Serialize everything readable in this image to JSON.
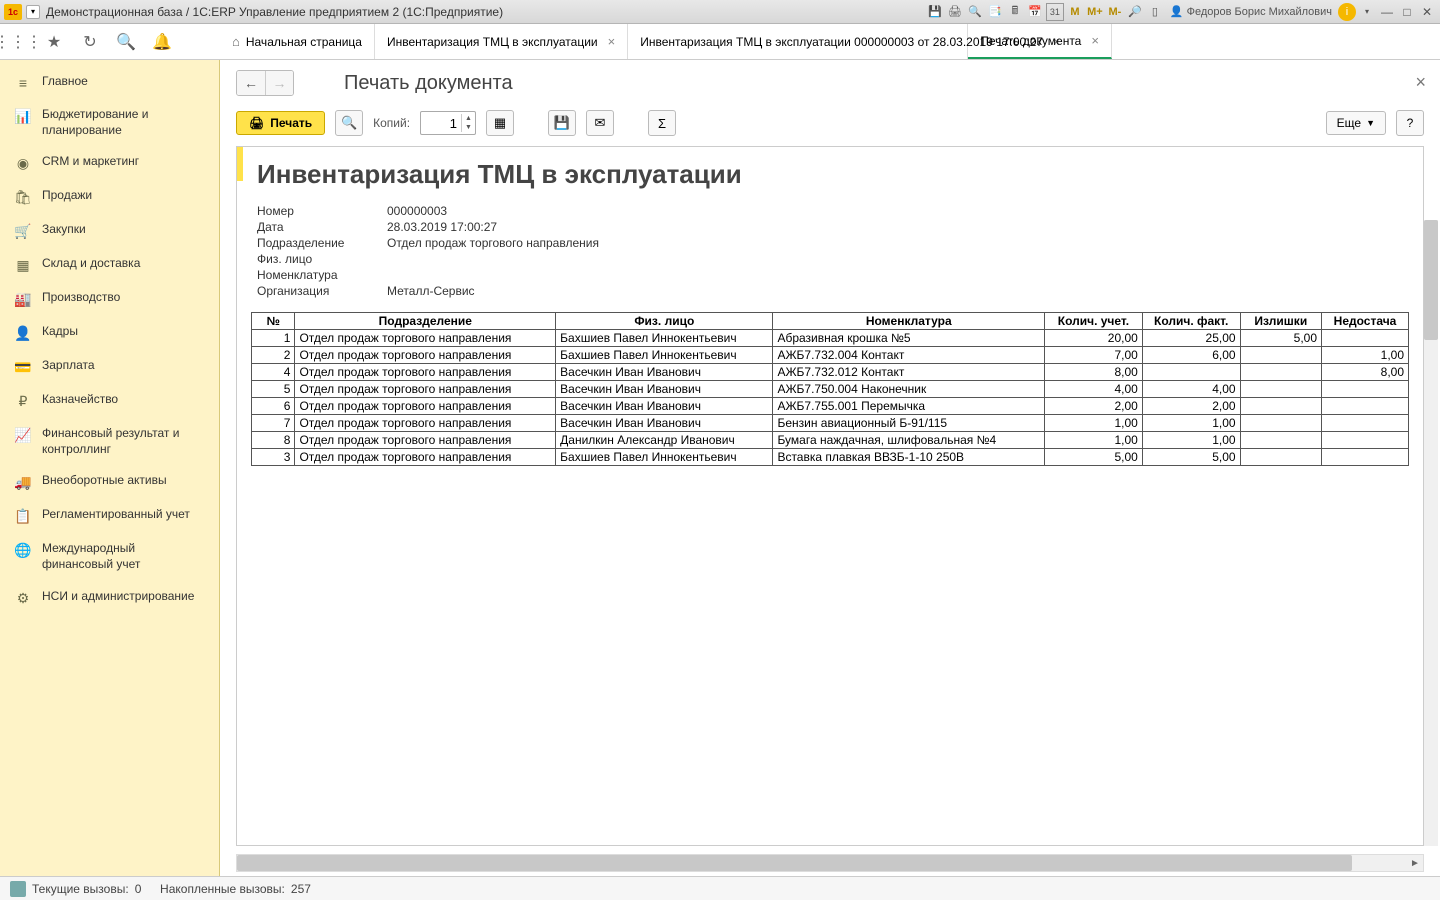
{
  "window": {
    "title": "Демонстрационная база / 1C:ERP Управление предприятием 2  (1С:Предприятие)",
    "user": "Федоров Борис Михайлович",
    "m_labels": [
      "M",
      "M+",
      "M-"
    ]
  },
  "tabs": [
    {
      "label": "Начальная страница",
      "home": true,
      "closable": false
    },
    {
      "label": "Инвентаризация ТМЦ в эксплуатации",
      "closable": true
    },
    {
      "label": "Инвентаризация ТМЦ в эксплуатации 000000003 от 28.03.2019 17:00:27",
      "closable": true
    },
    {
      "label": "Печать документа",
      "closable": true,
      "active": true
    }
  ],
  "sidebar": [
    {
      "icon": "≡",
      "label": "Главное"
    },
    {
      "icon": "📊",
      "label": "Бюджетирование и планирование"
    },
    {
      "icon": "◉",
      "label": "CRM и маркетинг"
    },
    {
      "icon": "🛍",
      "label": "Продажи"
    },
    {
      "icon": "🛒",
      "label": "Закупки"
    },
    {
      "icon": "▦",
      "label": "Склад и доставка"
    },
    {
      "icon": "🏭",
      "label": "Производство"
    },
    {
      "icon": "👤",
      "label": "Кадры"
    },
    {
      "icon": "💳",
      "label": "Зарплата"
    },
    {
      "icon": "₽",
      "label": "Казначейство"
    },
    {
      "icon": "📈",
      "label": "Финансовый результат и контроллинг"
    },
    {
      "icon": "🚚",
      "label": "Внеоборотные активы"
    },
    {
      "icon": "📋",
      "label": "Регламентированный учет"
    },
    {
      "icon": "🌐",
      "label": "Международный финансовый учет"
    },
    {
      "icon": "⚙",
      "label": "НСИ и администрирование"
    }
  ],
  "page": {
    "title": "Печать документа",
    "print_label": "Печать",
    "copies_label": "Копий:",
    "copies_value": "1",
    "more_label": "Еще",
    "help_label": "?"
  },
  "doc": {
    "title": "Инвентаризация ТМЦ в эксплуатации",
    "meta": [
      {
        "k": "Номер",
        "v": "000000003"
      },
      {
        "k": "Дата",
        "v": "28.03.2019 17:00:27"
      },
      {
        "k": "Подразделение",
        "v": "Отдел продаж торгового направления"
      },
      {
        "k": "Физ. лицо",
        "v": ""
      },
      {
        "k": "Номенклатура",
        "v": ""
      },
      {
        "k": "Организация",
        "v": "Металл-Сервис"
      }
    ],
    "columns": [
      "№",
      "Подразделение",
      "Физ. лицо",
      "Номенклатура",
      "Колич. учет.",
      "Колич. факт.",
      "Излишки",
      "Недостача"
    ],
    "rows": [
      {
        "n": "1",
        "dep": "Отдел продаж торгового направления",
        "fio": "Бахшиев Павел Иннокентьевич",
        "nom": "Абразивная крошка №5",
        "u": "20,00",
        "f": "25,00",
        "iz": "5,00",
        "nd": ""
      },
      {
        "n": "2",
        "dep": "Отдел продаж торгового направления",
        "fio": "Бахшиев Павел Иннокентьевич",
        "nom": "АЖБ7.732.004 Контакт",
        "u": "7,00",
        "f": "6,00",
        "iz": "",
        "nd": "1,00"
      },
      {
        "n": "4",
        "dep": "Отдел продаж торгового направления",
        "fio": "Васечкин Иван Иванович",
        "nom": "АЖБ7.732.012 Контакт",
        "u": "8,00",
        "f": "",
        "iz": "",
        "nd": "8,00"
      },
      {
        "n": "5",
        "dep": "Отдел продаж торгового направления",
        "fio": "Васечкин Иван Иванович",
        "nom": "АЖБ7.750.004 Наконечник",
        "u": "4,00",
        "f": "4,00",
        "iz": "",
        "nd": ""
      },
      {
        "n": "6",
        "dep": "Отдел продаж торгового направления",
        "fio": "Васечкин Иван Иванович",
        "nom": "АЖБ7.755.001 Перемычка",
        "u": "2,00",
        "f": "2,00",
        "iz": "",
        "nd": ""
      },
      {
        "n": "7",
        "dep": "Отдел продаж торгового направления",
        "fio": "Васечкин Иван Иванович",
        "nom": "Бензин авиационный Б-91/115",
        "u": "1,00",
        "f": "1,00",
        "iz": "",
        "nd": ""
      },
      {
        "n": "8",
        "dep": "Отдел продаж торгового направления",
        "fio": "Данилкин Александр Иванович",
        "nom": "Бумага наждачная, шлифовальная №4",
        "u": "1,00",
        "f": "1,00",
        "iz": "",
        "nd": ""
      },
      {
        "n": "3",
        "dep": "Отдел продаж торгового направления",
        "fio": "Бахшиев Павел Иннокентьевич",
        "nom": "Вставка плавкая ВВЗБ-1-10 250В",
        "u": "5,00",
        "f": "5,00",
        "iz": "",
        "nd": ""
      }
    ]
  },
  "status": {
    "current_label": "Текущие вызовы:",
    "current_value": "0",
    "acc_label": "Накопленные вызовы:",
    "acc_value": "257"
  }
}
